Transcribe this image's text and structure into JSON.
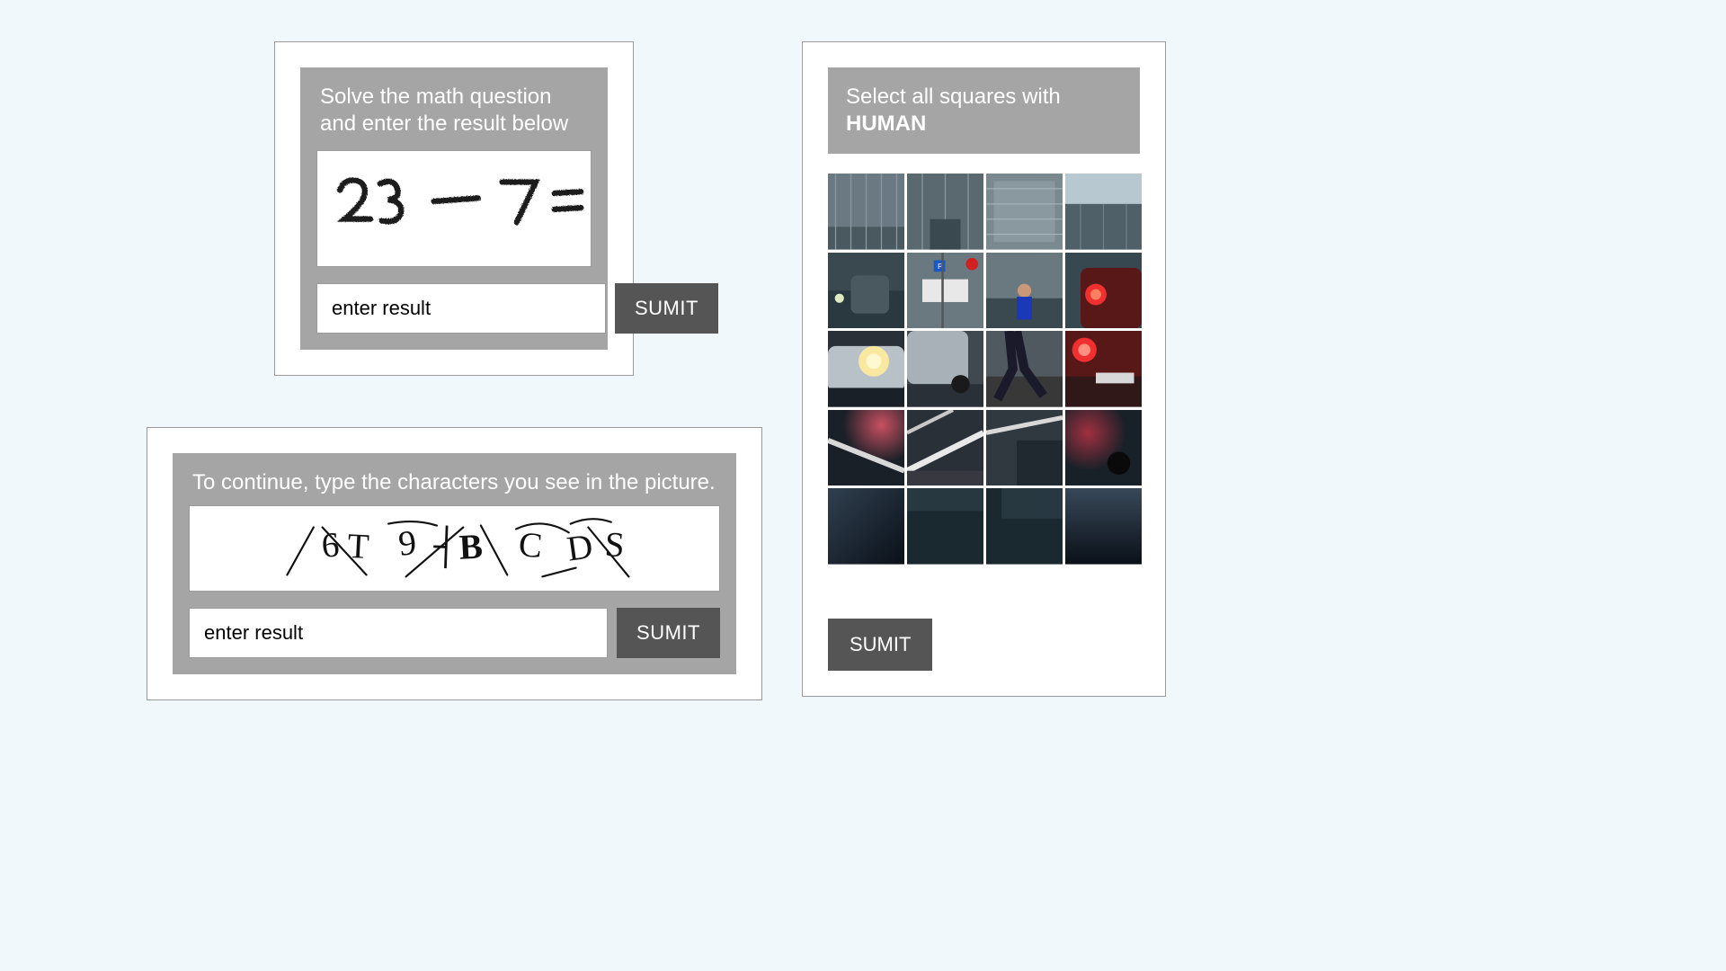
{
  "math": {
    "header_line1": "Solve the math question",
    "header_line2": "and enter the result below",
    "expression": "23 - 7 =",
    "input_placeholder": "enter result",
    "submit_label": "SUMIT"
  },
  "textcap": {
    "header": "To continue, type the characters you see in the picture.",
    "chars": "6T 9 B C D S",
    "input_placeholder": "enter result",
    "submit_label": "SUMIT"
  },
  "grid": {
    "header_line1": "Select all squares with",
    "header_target": "HUMAN",
    "submit_label": "SUMIT"
  }
}
